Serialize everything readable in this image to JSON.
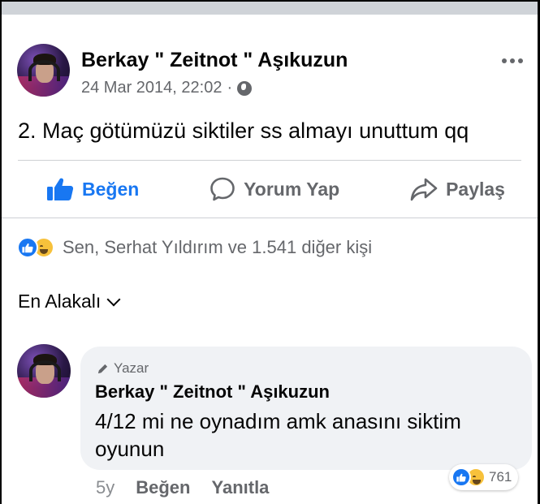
{
  "post": {
    "author": "Berkay \" Zeitnot \" Aşıkuzun",
    "timestamp": "24 Mar 2014, 22:02",
    "separator": "·",
    "audience_icon": "globe-icon",
    "text": "2. Maç götümüzü siktiler ss almayı unuttum qq"
  },
  "actions": {
    "like_label": "Beğen",
    "comment_label": "Yorum Yap",
    "share_label": "Paylaş"
  },
  "reactions": {
    "summary": "Sen, Serhat Yıldırım ve 1.541 diğer kişi",
    "types": [
      "like-icon",
      "haha-icon"
    ]
  },
  "sort": {
    "label": "En Alakalı"
  },
  "comment": {
    "badge": "Yazar",
    "author": "Berkay \" Zeitnot \" Aşıkuzun",
    "text": "4/12 mi ne oynadım amk anasını siktim oyunun",
    "age": "5y",
    "like_label": "Beğen",
    "reply_label": "Yanıtla",
    "reaction_count": "761"
  },
  "colors": {
    "accent": "#1877f2",
    "secondary_text": "#65676b",
    "bubble": "#f0f2f5"
  }
}
